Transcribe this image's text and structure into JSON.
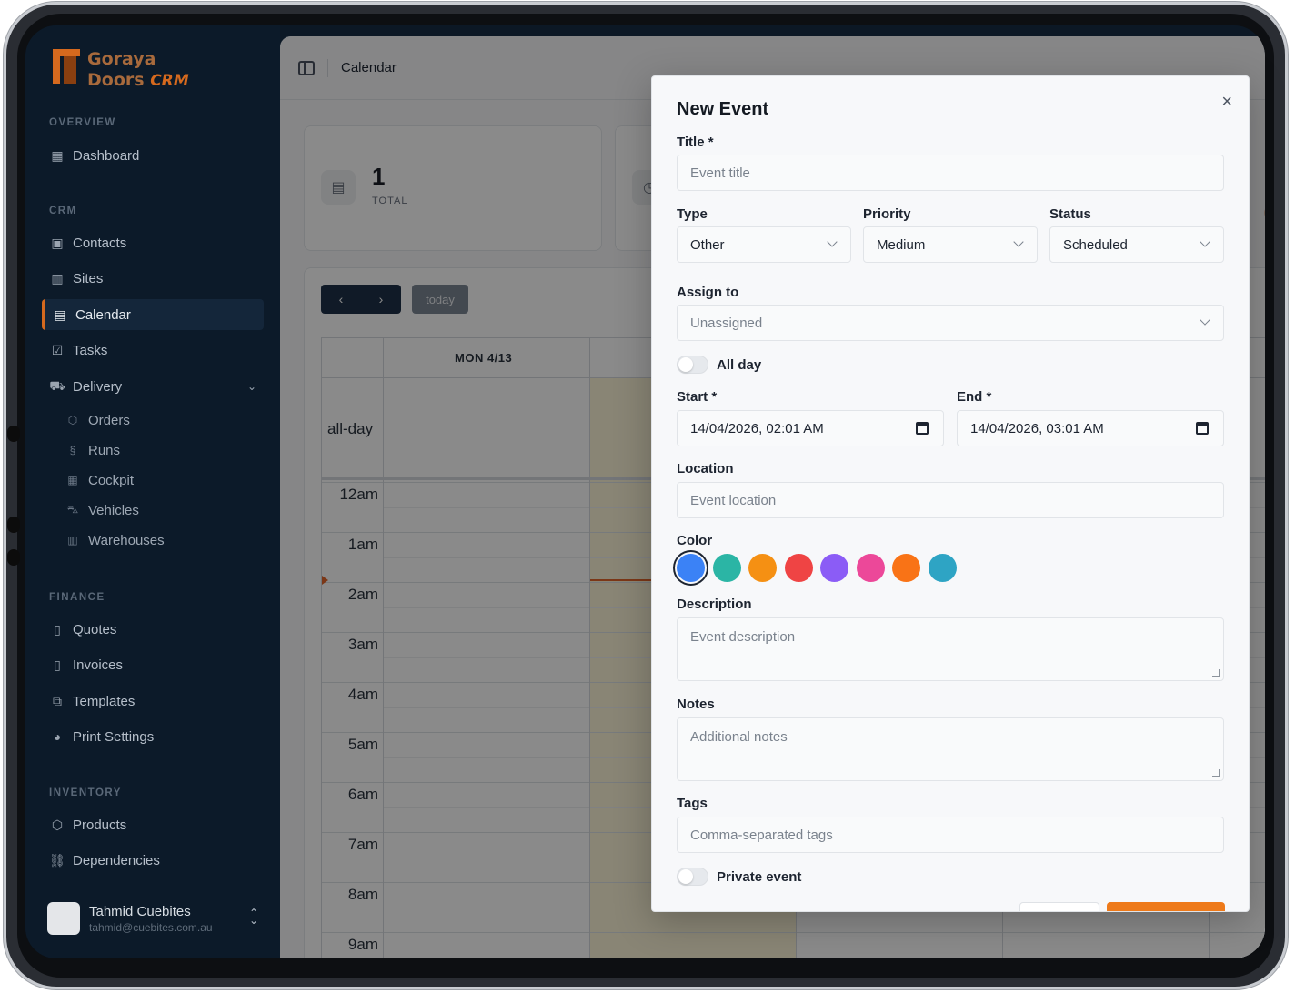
{
  "brand": {
    "line1": "Goraya",
    "line2": "Doors",
    "line3": "CRM"
  },
  "sidebar": {
    "sections": {
      "overview": "OVERVIEW",
      "crm": "CRM",
      "finance": "FINANCE",
      "inventory": "INVENTORY"
    },
    "items": {
      "dashboard": "Dashboard",
      "contacts": "Contacts",
      "sites": "Sites",
      "calendar": "Calendar",
      "tasks": "Tasks",
      "delivery": "Delivery",
      "orders": "Orders",
      "runs": "Runs",
      "cockpit": "Cockpit",
      "vehicles": "Vehicles",
      "warehouses": "Warehouses",
      "quotes": "Quotes",
      "invoices": "Invoices",
      "templates": "Templates",
      "print_settings": "Print Settings",
      "products": "Products",
      "dependencies": "Dependencies"
    },
    "user": {
      "name": "Tahmid Cuebites",
      "email": "tahmid@cuebites.com.au"
    }
  },
  "header": {
    "title": "Calendar"
  },
  "stats": {
    "total_value": "1",
    "total_label": "TOTAL"
  },
  "calendar": {
    "prev": "‹",
    "next": "›",
    "today": "today",
    "day_label": "MON 4/13",
    "allday_label": "all-day",
    "hours": [
      "12am",
      "1am",
      "2am",
      "3am",
      "4am",
      "5am",
      "6am",
      "7am",
      "8am",
      "9am"
    ]
  },
  "modal": {
    "title": "New Event",
    "close": "×",
    "title_label": "Title *",
    "title_placeholder": "Event title",
    "type_label": "Type",
    "type_value": "Other",
    "priority_label": "Priority",
    "priority_value": "Medium",
    "status_label": "Status",
    "status_value": "Scheduled",
    "assign_label": "Assign to",
    "assign_value": "Unassigned",
    "allday_label": "All day",
    "start_label": "Start *",
    "start_value": "14/04/2026, 02:01 AM",
    "end_label": "End *",
    "end_value": "14/04/2026, 03:01 AM",
    "location_label": "Location",
    "location_placeholder": "Event location",
    "color_label": "Color",
    "colors": [
      "#3b82f6",
      "#2bb5a5",
      "#f59013",
      "#ef4444",
      "#8b5cf6",
      "#ec4899",
      "#f97316",
      "#2ea4c4"
    ],
    "description_label": "Description",
    "description_placeholder": "Event description",
    "notes_label": "Notes",
    "notes_placeholder": "Additional notes",
    "tags_label": "Tags",
    "tags_placeholder": "Comma-separated tags",
    "private_label": "Private event"
  }
}
